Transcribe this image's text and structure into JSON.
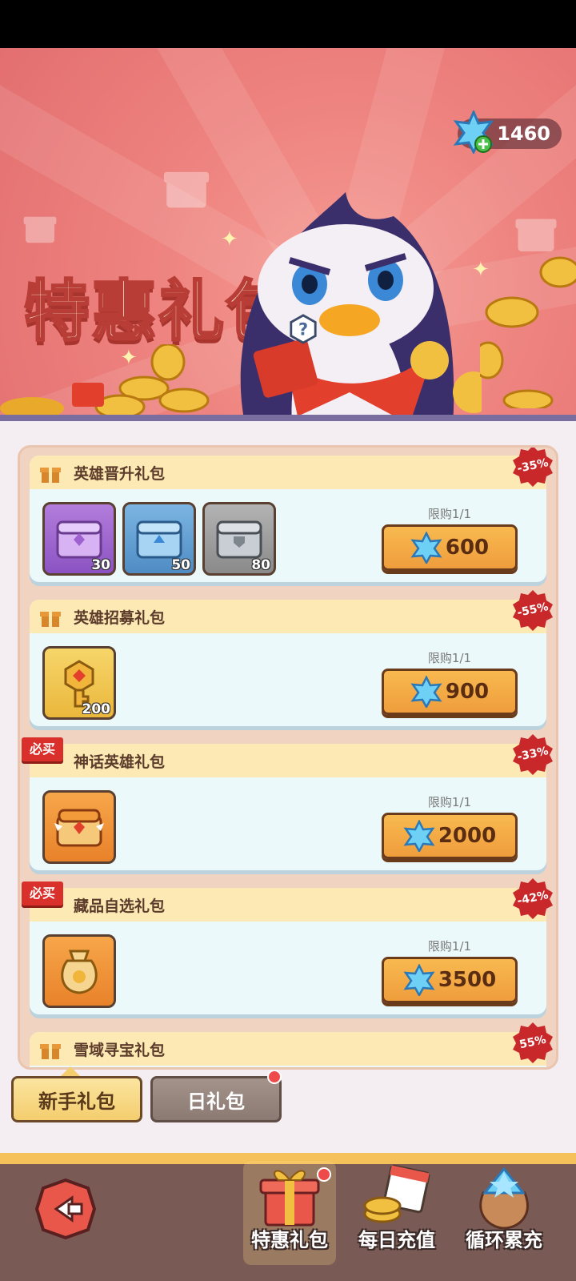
{
  "banner": {
    "title": "特惠礼包",
    "gem_balance": "1460"
  },
  "packs": [
    {
      "title": "英雄晋升礼包",
      "badge": "",
      "discount": "-35%",
      "items": [
        {
          "icon": "purple-chest-icon",
          "count": "30"
        },
        {
          "icon": "blue-chest-icon",
          "count": "50"
        },
        {
          "icon": "gray-chest-icon",
          "count": "80"
        }
      ],
      "limit": "限购1/1",
      "price": "600"
    },
    {
      "title": "英雄招募礼包",
      "badge": "",
      "discount": "-55%",
      "items": [
        {
          "icon": "golden-key-icon",
          "count": "200"
        }
      ],
      "limit": "限购1/1",
      "price": "900"
    },
    {
      "title": "神话英雄礼包",
      "badge": "必买",
      "discount": "-33%",
      "items": [
        {
          "icon": "mythic-chest-icon",
          "count": ""
        }
      ],
      "limit": "限购1/1",
      "price": "2000"
    },
    {
      "title": "藏品自选礼包",
      "badge": "必买",
      "discount": "-42%",
      "items": [
        {
          "icon": "treasure-bag-icon",
          "count": ""
        }
      ],
      "limit": "限购1/1",
      "price": "3500"
    },
    {
      "title": "雪域寻宝礼包",
      "badge": "",
      "discount": "55%"
    }
  ],
  "tabs": {
    "newbie": "新手礼包",
    "daily": "日礼包"
  },
  "bottom_nav": {
    "special": "特惠礼包",
    "daily_recharge": "每日充值",
    "cumulative": "循环累充"
  },
  "colors": {
    "banner_bg": "#ee837f",
    "button": "#f3a843",
    "header": "#fde9b4",
    "card": "#ecf9fb",
    "badge": "#d9302b"
  }
}
